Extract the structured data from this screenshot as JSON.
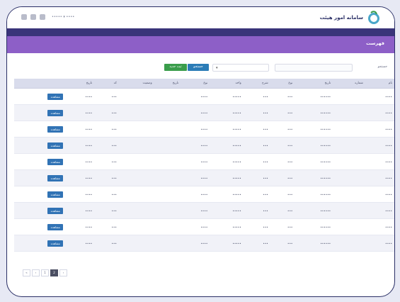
{
  "topbar": {
    "user_menu": "••••• ▾ ••••",
    "brand_name": "سامانه امور هیئت"
  },
  "page": {
    "title": "فهرست"
  },
  "toolbar": {
    "search_label": "جستجو",
    "search_placeholder": "",
    "btn_a_label": "جستجو",
    "btn_b_label": "ثبت جدید"
  },
  "table": {
    "headers": [
      "",
      "تاریخ",
      "کد",
      "وضعیت",
      "تاریخ",
      "نوع",
      "واحد",
      "شرح",
      "نوع",
      "تاریخ",
      "شماره",
      "نام"
    ],
    "rows": [
      {
        "action": "مشاهده",
        "c1": "••••",
        "c2": "•••",
        "c3": "",
        "c4": "",
        "c5": "••••",
        "c6": "•••••",
        "c7": "•••",
        "c8": "•••",
        "c9": "••••••",
        "c10": "",
        "c11": "••••"
      },
      {
        "action": "مشاهده",
        "c1": "••••",
        "c2": "•••",
        "c3": "",
        "c4": "",
        "c5": "••••",
        "c6": "•••••",
        "c7": "•••",
        "c8": "•••",
        "c9": "••••••",
        "c10": "",
        "c11": "••••"
      },
      {
        "action": "مشاهده",
        "c1": "••••",
        "c2": "•••",
        "c3": "",
        "c4": "",
        "c5": "••••",
        "c6": "•••••",
        "c7": "•••",
        "c8": "•••",
        "c9": "••••••",
        "c10": "",
        "c11": "••••"
      },
      {
        "action": "مشاهده",
        "c1": "••••",
        "c2": "•••",
        "c3": "",
        "c4": "",
        "c5": "••••",
        "c6": "•••••",
        "c7": "•••",
        "c8": "•••",
        "c9": "••••••",
        "c10": "",
        "c11": "••••"
      },
      {
        "action": "مشاهده",
        "c1": "••••",
        "c2": "•••",
        "c3": "",
        "c4": "",
        "c5": "••••",
        "c6": "•••••",
        "c7": "•••",
        "c8": "•••",
        "c9": "••••••",
        "c10": "",
        "c11": "••••"
      },
      {
        "action": "مشاهده",
        "c1": "••••",
        "c2": "•••",
        "c3": "",
        "c4": "",
        "c5": "••••",
        "c6": "•••••",
        "c7": "•••",
        "c8": "•••",
        "c9": "••••••",
        "c10": "",
        "c11": "••••"
      },
      {
        "action": "مشاهده",
        "c1": "••••",
        "c2": "•••",
        "c3": "",
        "c4": "",
        "c5": "••••",
        "c6": "•••••",
        "c7": "•••",
        "c8": "•••",
        "c9": "••••••",
        "c10": "",
        "c11": "••••"
      },
      {
        "action": "مشاهده",
        "c1": "••••",
        "c2": "•••",
        "c3": "",
        "c4": "",
        "c5": "••••",
        "c6": "•••••",
        "c7": "•••",
        "c8": "•••",
        "c9": "••••••",
        "c10": "",
        "c11": "••••"
      },
      {
        "action": "مشاهده",
        "c1": "••••",
        "c2": "•••",
        "c3": "",
        "c4": "",
        "c5": "••••",
        "c6": "•••••",
        "c7": "•••",
        "c8": "•••",
        "c9": "••••••",
        "c10": "",
        "c11": "••••"
      },
      {
        "action": "مشاهده",
        "c1": "••••",
        "c2": "•••",
        "c3": "",
        "c4": "",
        "c5": "••••",
        "c6": "•••••",
        "c7": "•••",
        "c8": "•••",
        "c9": "••••••",
        "c10": "",
        "c11": "••••"
      }
    ]
  },
  "pagination": {
    "items": [
      "«",
      "‹",
      "1",
      "2",
      "›"
    ],
    "active_index": 3
  },
  "colors": {
    "primary": "#3a347a",
    "accent": "#8d5fc7",
    "btn_blue": "#2b7cb7",
    "btn_green": "#3a9d4b"
  }
}
